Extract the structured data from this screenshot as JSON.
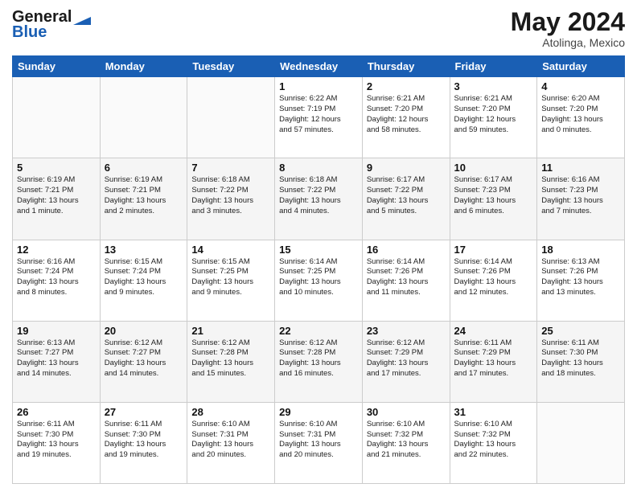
{
  "header": {
    "logo_line1": "General",
    "logo_line2": "Blue",
    "month": "May 2024",
    "location": "Atolinga, Mexico"
  },
  "days_of_week": [
    "Sunday",
    "Monday",
    "Tuesday",
    "Wednesday",
    "Thursday",
    "Friday",
    "Saturday"
  ],
  "weeks": [
    [
      {
        "num": "",
        "info": ""
      },
      {
        "num": "",
        "info": ""
      },
      {
        "num": "",
        "info": ""
      },
      {
        "num": "1",
        "info": "Sunrise: 6:22 AM\nSunset: 7:19 PM\nDaylight: 12 hours\nand 57 minutes."
      },
      {
        "num": "2",
        "info": "Sunrise: 6:21 AM\nSunset: 7:20 PM\nDaylight: 12 hours\nand 58 minutes."
      },
      {
        "num": "3",
        "info": "Sunrise: 6:21 AM\nSunset: 7:20 PM\nDaylight: 12 hours\nand 59 minutes."
      },
      {
        "num": "4",
        "info": "Sunrise: 6:20 AM\nSunset: 7:20 PM\nDaylight: 13 hours\nand 0 minutes."
      }
    ],
    [
      {
        "num": "5",
        "info": "Sunrise: 6:19 AM\nSunset: 7:21 PM\nDaylight: 13 hours\nand 1 minute."
      },
      {
        "num": "6",
        "info": "Sunrise: 6:19 AM\nSunset: 7:21 PM\nDaylight: 13 hours\nand 2 minutes."
      },
      {
        "num": "7",
        "info": "Sunrise: 6:18 AM\nSunset: 7:22 PM\nDaylight: 13 hours\nand 3 minutes."
      },
      {
        "num": "8",
        "info": "Sunrise: 6:18 AM\nSunset: 7:22 PM\nDaylight: 13 hours\nand 4 minutes."
      },
      {
        "num": "9",
        "info": "Sunrise: 6:17 AM\nSunset: 7:22 PM\nDaylight: 13 hours\nand 5 minutes."
      },
      {
        "num": "10",
        "info": "Sunrise: 6:17 AM\nSunset: 7:23 PM\nDaylight: 13 hours\nand 6 minutes."
      },
      {
        "num": "11",
        "info": "Sunrise: 6:16 AM\nSunset: 7:23 PM\nDaylight: 13 hours\nand 7 minutes."
      }
    ],
    [
      {
        "num": "12",
        "info": "Sunrise: 6:16 AM\nSunset: 7:24 PM\nDaylight: 13 hours\nand 8 minutes."
      },
      {
        "num": "13",
        "info": "Sunrise: 6:15 AM\nSunset: 7:24 PM\nDaylight: 13 hours\nand 9 minutes."
      },
      {
        "num": "14",
        "info": "Sunrise: 6:15 AM\nSunset: 7:25 PM\nDaylight: 13 hours\nand 9 minutes."
      },
      {
        "num": "15",
        "info": "Sunrise: 6:14 AM\nSunset: 7:25 PM\nDaylight: 13 hours\nand 10 minutes."
      },
      {
        "num": "16",
        "info": "Sunrise: 6:14 AM\nSunset: 7:26 PM\nDaylight: 13 hours\nand 11 minutes."
      },
      {
        "num": "17",
        "info": "Sunrise: 6:14 AM\nSunset: 7:26 PM\nDaylight: 13 hours\nand 12 minutes."
      },
      {
        "num": "18",
        "info": "Sunrise: 6:13 AM\nSunset: 7:26 PM\nDaylight: 13 hours\nand 13 minutes."
      }
    ],
    [
      {
        "num": "19",
        "info": "Sunrise: 6:13 AM\nSunset: 7:27 PM\nDaylight: 13 hours\nand 14 minutes."
      },
      {
        "num": "20",
        "info": "Sunrise: 6:12 AM\nSunset: 7:27 PM\nDaylight: 13 hours\nand 14 minutes."
      },
      {
        "num": "21",
        "info": "Sunrise: 6:12 AM\nSunset: 7:28 PM\nDaylight: 13 hours\nand 15 minutes."
      },
      {
        "num": "22",
        "info": "Sunrise: 6:12 AM\nSunset: 7:28 PM\nDaylight: 13 hours\nand 16 minutes."
      },
      {
        "num": "23",
        "info": "Sunrise: 6:12 AM\nSunset: 7:29 PM\nDaylight: 13 hours\nand 17 minutes."
      },
      {
        "num": "24",
        "info": "Sunrise: 6:11 AM\nSunset: 7:29 PM\nDaylight: 13 hours\nand 17 minutes."
      },
      {
        "num": "25",
        "info": "Sunrise: 6:11 AM\nSunset: 7:30 PM\nDaylight: 13 hours\nand 18 minutes."
      }
    ],
    [
      {
        "num": "26",
        "info": "Sunrise: 6:11 AM\nSunset: 7:30 PM\nDaylight: 13 hours\nand 19 minutes."
      },
      {
        "num": "27",
        "info": "Sunrise: 6:11 AM\nSunset: 7:30 PM\nDaylight: 13 hours\nand 19 minutes."
      },
      {
        "num": "28",
        "info": "Sunrise: 6:10 AM\nSunset: 7:31 PM\nDaylight: 13 hours\nand 20 minutes."
      },
      {
        "num": "29",
        "info": "Sunrise: 6:10 AM\nSunset: 7:31 PM\nDaylight: 13 hours\nand 20 minutes."
      },
      {
        "num": "30",
        "info": "Sunrise: 6:10 AM\nSunset: 7:32 PM\nDaylight: 13 hours\nand 21 minutes."
      },
      {
        "num": "31",
        "info": "Sunrise: 6:10 AM\nSunset: 7:32 PM\nDaylight: 13 hours\nand 22 minutes."
      },
      {
        "num": "",
        "info": ""
      }
    ]
  ]
}
